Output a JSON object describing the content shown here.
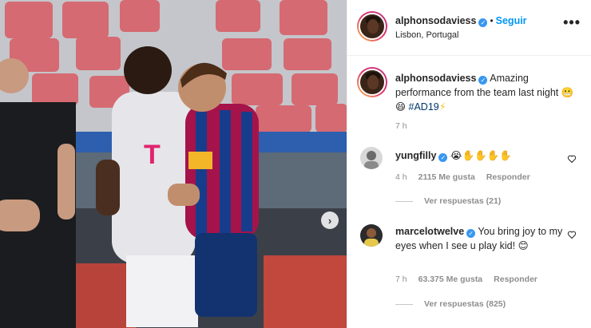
{
  "post": {
    "author": "alphonsodaviess",
    "follow_label": "Seguir",
    "location": "Lisbon, Portugal",
    "more_label": "•••",
    "caption": "Amazing performance from the team last night",
    "caption_emojis": "😬😄",
    "hashtag": "#AD19",
    "hashtag_emoji": "⚡",
    "time": "7 h",
    "next_label": "›"
  },
  "comments": [
    {
      "username": "yungfilly",
      "text": "😭✋✋✋✋",
      "time": "4 h",
      "likes": "2115 Me gusta",
      "reply": "Responder",
      "view_replies": "Ver respuestas (21)"
    },
    {
      "username": "marcelotwelve",
      "text": "You bring joy to my eyes when I see u play kid!",
      "emoji": "😊",
      "time": "7 h",
      "likes": "63.375 Me gusta",
      "reply": "Responder",
      "view_replies": "Ver respuestas (825)"
    }
  ],
  "colors": {
    "link_blue": "#0095f6",
    "verified_blue": "#3897f0",
    "hashtag_blue": "#00376b",
    "muted_gray": "#8e8e8e"
  }
}
